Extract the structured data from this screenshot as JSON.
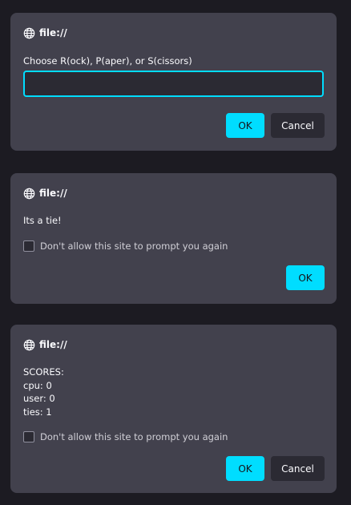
{
  "colors": {
    "background": "#1c1b22",
    "dialog": "#42414d",
    "accent": "#00ddff",
    "field": "#2b2a33"
  },
  "dialogs": [
    {
      "origin": "file://",
      "origin_icon": "globe-icon",
      "message": "Choose R(ock), P(aper), or S(cissors)",
      "input_value": "",
      "ok_label": "OK",
      "cancel_label": "Cancel"
    },
    {
      "origin": "file://",
      "origin_icon": "globe-icon",
      "message": "Its a tie!",
      "checkbox_label": "Don't allow this site to prompt you again",
      "checkbox_checked": false,
      "ok_label": "OK"
    },
    {
      "origin": "file://",
      "origin_icon": "globe-icon",
      "message_lines": [
        "SCORES:",
        "cpu: 0",
        "user: 0",
        "ties: 1"
      ],
      "checkbox_label": "Don't allow this site to prompt you again",
      "checkbox_checked": false,
      "ok_label": "OK",
      "cancel_label": "Cancel"
    }
  ]
}
